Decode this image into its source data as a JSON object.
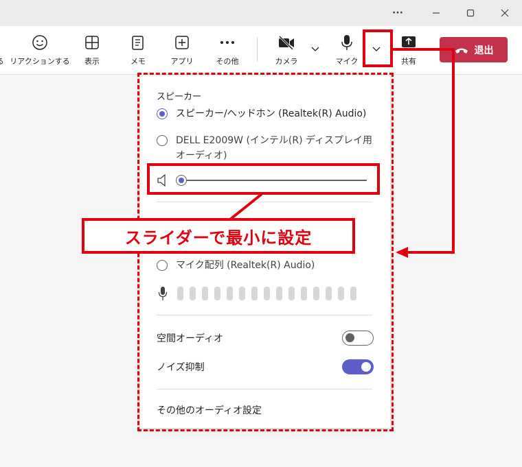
{
  "titlebar": {
    "more": "···",
    "minimize": "—",
    "maximize": "□",
    "close": "✕"
  },
  "toolbar": {
    "items": [
      {
        "label": "る",
        "icon": "share-tray-icon"
      },
      {
        "label": "リアクションする",
        "icon": "smiley-icon"
      },
      {
        "label": "表示",
        "icon": "grid-icon"
      },
      {
        "label": "メモ",
        "icon": "notes-icon"
      },
      {
        "label": "アプリ",
        "icon": "add-app-icon"
      },
      {
        "label": "その他",
        "icon": "more-icon"
      },
      {
        "label": "カメラ",
        "icon": "camera-off-icon"
      },
      {
        "label": "マイク",
        "icon": "microphone-icon"
      },
      {
        "label": "共有",
        "icon": "share-screen-icon"
      }
    ],
    "leave_label": "退出",
    "leave_color": "#c4314b"
  },
  "panel": {
    "speaker_title": "スピーカー",
    "speaker_options": [
      {
        "label": "スピーカー/ヘッドホン (Realtek(R) Audio)",
        "selected": true
      },
      {
        "label_line1": "DELL E2009W (インテル(R) ディスプレイ用",
        "label_line2": "オーディオ)",
        "selected": false
      }
    ],
    "speaker_volume": 0,
    "mic_option": {
      "label": "マイク配列 (Realtek(R) Audio)",
      "selected": false
    },
    "spatial_audio": {
      "label": "空間オーディオ",
      "on": false
    },
    "noise_suppression": {
      "label": "ノイズ抑制",
      "on": true
    },
    "more_settings": "その他のオーディオ設定",
    "accent": "#5b5fc7"
  },
  "annotation": {
    "callout_text": "スライダーで最小に設定",
    "color": "#e00010"
  }
}
